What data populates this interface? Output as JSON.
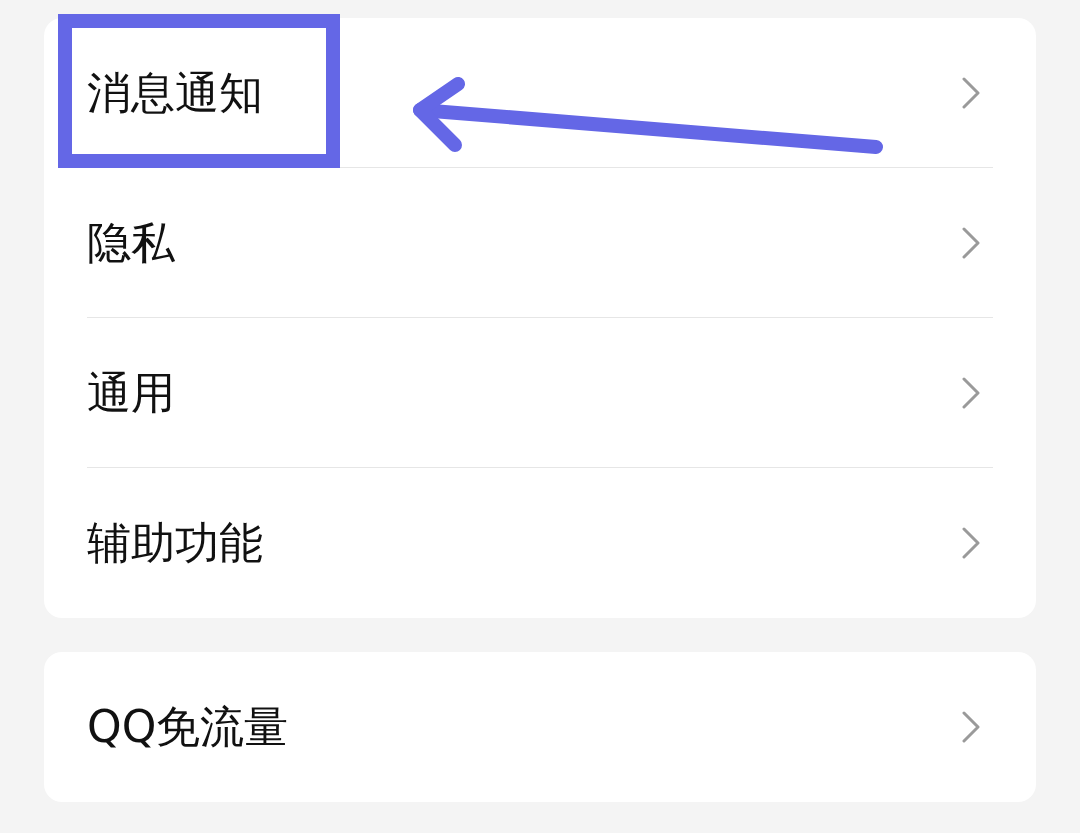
{
  "groups": [
    {
      "items": [
        {
          "label": "消息通知",
          "highlighted": true
        },
        {
          "label": "隐私",
          "highlighted": false
        },
        {
          "label": "通用",
          "highlighted": false
        },
        {
          "label": "辅助功能",
          "highlighted": false
        }
      ]
    },
    {
      "items": [
        {
          "label": "QQ免流量",
          "highlighted": false
        }
      ]
    }
  ]
}
